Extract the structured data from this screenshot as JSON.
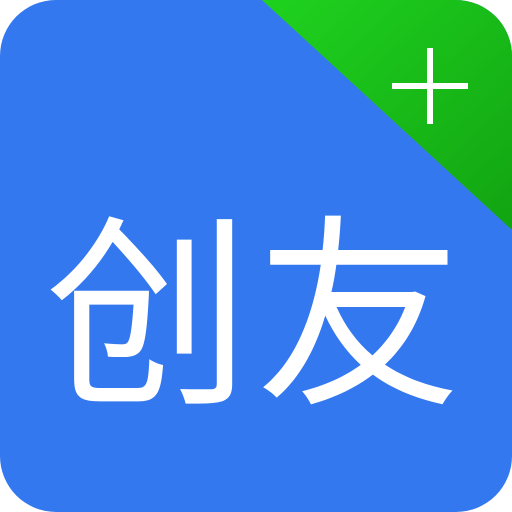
{
  "app_icon": {
    "name": "创友",
    "badge_icon": "plus-icon",
    "colors": {
      "background": "#3478EF",
      "corner_band": "#1FD21F",
      "corner_band_edge": "#12A412",
      "foreground": "#FFFFFF"
    }
  }
}
